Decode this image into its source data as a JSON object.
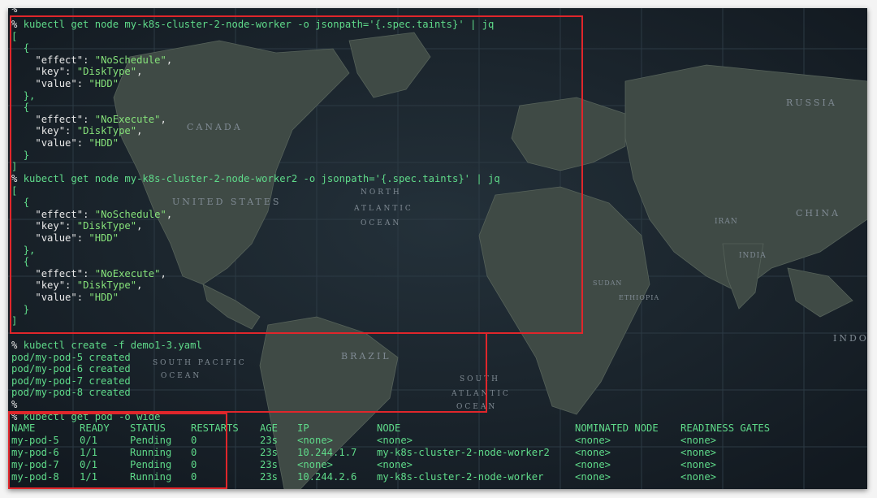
{
  "terminal": {
    "colors": {
      "background": "#141b22",
      "prompt": "#4ee98a",
      "string": "#86e27a",
      "highlight_box": "#e0262b"
    },
    "top_prompt": "%",
    "cmd1": {
      "prompt": "%",
      "command": "kubectl get node my-k8s-cluster-2-node-worker -o jsonpath='{.spec.taints}' | jq"
    },
    "json1": [
      {
        "effect": "\"NoSchedule\"",
        "key": "\"DiskType\"",
        "value": "\"HDD\""
      },
      {
        "effect": "\"NoExecute\"",
        "key": "\"DiskType\"",
        "value": "\"HDD\""
      }
    ],
    "cmd2": {
      "prompt": "%",
      "command": "kubectl get node my-k8s-cluster-2-node-worker2 -o jsonpath='{.spec.taints}' | jq"
    },
    "json2": [
      {
        "effect": "\"NoSchedule\"",
        "key": "\"DiskType\"",
        "value": "\"HDD\""
      },
      {
        "effect": "\"NoExecute\"",
        "key": "\"DiskType\"",
        "value": "\"HDD\""
      }
    ],
    "json_keys": {
      "effect": "\"effect\"",
      "key": "\"key\"",
      "value": "\"value\""
    },
    "punct": {
      "open_bracket": "[",
      "close_bracket": "]",
      "open_brace": "{",
      "close_brace": "}",
      "close_brace_comma": "},",
      "colon": ": ",
      "comma": ","
    },
    "cmd3": {
      "prompt": "%",
      "command": "kubectl create -f demo1-3.yaml"
    },
    "create_output": [
      "pod/my-pod-5 created",
      "pod/my-pod-6 created",
      "pod/my-pod-7 created",
      "pod/my-pod-8 created"
    ],
    "empty_prompt": "%",
    "cmd4": {
      "prompt": "%",
      "command": "kubectl get pod -o wide"
    },
    "pod_table": {
      "headers": [
        "NAME",
        "READY",
        "STATUS",
        "RESTARTS",
        "AGE",
        "IP",
        "NODE",
        "NOMINATED NODE",
        "READINESS GATES"
      ],
      "rows": [
        [
          "my-pod-5",
          "0/1",
          "Pending",
          "0",
          "23s",
          "<none>",
          "<none>",
          "<none>",
          "<none>"
        ],
        [
          "my-pod-6",
          "1/1",
          "Running",
          "0",
          "23s",
          "10.244.1.7",
          "my-k8s-cluster-2-node-worker2",
          "<none>",
          "<none>"
        ],
        [
          "my-pod-7",
          "0/1",
          "Pending",
          "0",
          "23s",
          "<none>",
          "<none>",
          "<none>",
          "<none>"
        ],
        [
          "my-pod-8",
          "1/1",
          "Running",
          "0",
          "23s",
          "10.244.2.6",
          "my-k8s-cluster-2-node-worker",
          "<none>",
          "<none>"
        ]
      ]
    }
  },
  "map_labels": {
    "canada": "CANADA",
    "russia": "RUSSIA",
    "united_states": "UNITED STATES",
    "china": "CHINA",
    "north": "NORTH",
    "atlantic": "ATLANTIC",
    "ocean": "OCEAN",
    "brazil": "BRAZIL",
    "south_pacific": "SOUTH PACIFIC",
    "ocean2": "OCEAN",
    "south": "SOUTH",
    "atlantic2": "ATLANTIC",
    "ocean3": "OCEAN",
    "indo": "INDO",
    "iran": "IRAN",
    "india": "INDIA",
    "sudan": "SUDAN",
    "ethiopia": "ETHIOPIA"
  }
}
